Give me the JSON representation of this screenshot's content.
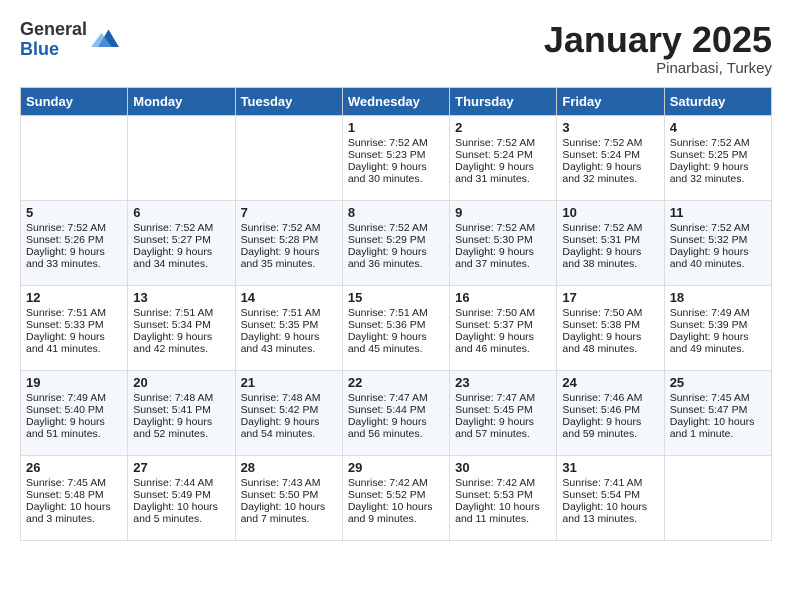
{
  "header": {
    "logo_general": "General",
    "logo_blue": "Blue",
    "month": "January 2025",
    "location": "Pinarbasi, Turkey"
  },
  "weekdays": [
    "Sunday",
    "Monday",
    "Tuesday",
    "Wednesday",
    "Thursday",
    "Friday",
    "Saturday"
  ],
  "weeks": [
    [
      {
        "day": "",
        "empty": true
      },
      {
        "day": "",
        "empty": true
      },
      {
        "day": "",
        "empty": true
      },
      {
        "day": "1",
        "sunrise": "7:52 AM",
        "sunset": "5:23 PM",
        "daylight": "9 hours and 30 minutes."
      },
      {
        "day": "2",
        "sunrise": "7:52 AM",
        "sunset": "5:24 PM",
        "daylight": "9 hours and 31 minutes."
      },
      {
        "day": "3",
        "sunrise": "7:52 AM",
        "sunset": "5:24 PM",
        "daylight": "9 hours and 32 minutes."
      },
      {
        "day": "4",
        "sunrise": "7:52 AM",
        "sunset": "5:25 PM",
        "daylight": "9 hours and 32 minutes."
      }
    ],
    [
      {
        "day": "5",
        "sunrise": "7:52 AM",
        "sunset": "5:26 PM",
        "daylight": "9 hours and 33 minutes."
      },
      {
        "day": "6",
        "sunrise": "7:52 AM",
        "sunset": "5:27 PM",
        "daylight": "9 hours and 34 minutes."
      },
      {
        "day": "7",
        "sunrise": "7:52 AM",
        "sunset": "5:28 PM",
        "daylight": "9 hours and 35 minutes."
      },
      {
        "day": "8",
        "sunrise": "7:52 AM",
        "sunset": "5:29 PM",
        "daylight": "9 hours and 36 minutes."
      },
      {
        "day": "9",
        "sunrise": "7:52 AM",
        "sunset": "5:30 PM",
        "daylight": "9 hours and 37 minutes."
      },
      {
        "day": "10",
        "sunrise": "7:52 AM",
        "sunset": "5:31 PM",
        "daylight": "9 hours and 38 minutes."
      },
      {
        "day": "11",
        "sunrise": "7:52 AM",
        "sunset": "5:32 PM",
        "daylight": "9 hours and 40 minutes."
      }
    ],
    [
      {
        "day": "12",
        "sunrise": "7:51 AM",
        "sunset": "5:33 PM",
        "daylight": "9 hours and 41 minutes."
      },
      {
        "day": "13",
        "sunrise": "7:51 AM",
        "sunset": "5:34 PM",
        "daylight": "9 hours and 42 minutes."
      },
      {
        "day": "14",
        "sunrise": "7:51 AM",
        "sunset": "5:35 PM",
        "daylight": "9 hours and 43 minutes."
      },
      {
        "day": "15",
        "sunrise": "7:51 AM",
        "sunset": "5:36 PM",
        "daylight": "9 hours and 45 minutes."
      },
      {
        "day": "16",
        "sunrise": "7:50 AM",
        "sunset": "5:37 PM",
        "daylight": "9 hours and 46 minutes."
      },
      {
        "day": "17",
        "sunrise": "7:50 AM",
        "sunset": "5:38 PM",
        "daylight": "9 hours and 48 minutes."
      },
      {
        "day": "18",
        "sunrise": "7:49 AM",
        "sunset": "5:39 PM",
        "daylight": "9 hours and 49 minutes."
      }
    ],
    [
      {
        "day": "19",
        "sunrise": "7:49 AM",
        "sunset": "5:40 PM",
        "daylight": "9 hours and 51 minutes."
      },
      {
        "day": "20",
        "sunrise": "7:48 AM",
        "sunset": "5:41 PM",
        "daylight": "9 hours and 52 minutes."
      },
      {
        "day": "21",
        "sunrise": "7:48 AM",
        "sunset": "5:42 PM",
        "daylight": "9 hours and 54 minutes."
      },
      {
        "day": "22",
        "sunrise": "7:47 AM",
        "sunset": "5:44 PM",
        "daylight": "9 hours and 56 minutes."
      },
      {
        "day": "23",
        "sunrise": "7:47 AM",
        "sunset": "5:45 PM",
        "daylight": "9 hours and 57 minutes."
      },
      {
        "day": "24",
        "sunrise": "7:46 AM",
        "sunset": "5:46 PM",
        "daylight": "9 hours and 59 minutes."
      },
      {
        "day": "25",
        "sunrise": "7:45 AM",
        "sunset": "5:47 PM",
        "daylight": "10 hours and 1 minute."
      }
    ],
    [
      {
        "day": "26",
        "sunrise": "7:45 AM",
        "sunset": "5:48 PM",
        "daylight": "10 hours and 3 minutes."
      },
      {
        "day": "27",
        "sunrise": "7:44 AM",
        "sunset": "5:49 PM",
        "daylight": "10 hours and 5 minutes."
      },
      {
        "day": "28",
        "sunrise": "7:43 AM",
        "sunset": "5:50 PM",
        "daylight": "10 hours and 7 minutes."
      },
      {
        "day": "29",
        "sunrise": "7:42 AM",
        "sunset": "5:52 PM",
        "daylight": "10 hours and 9 minutes."
      },
      {
        "day": "30",
        "sunrise": "7:42 AM",
        "sunset": "5:53 PM",
        "daylight": "10 hours and 11 minutes."
      },
      {
        "day": "31",
        "sunrise": "7:41 AM",
        "sunset": "5:54 PM",
        "daylight": "10 hours and 13 minutes."
      },
      {
        "day": "",
        "empty": true
      }
    ]
  ]
}
